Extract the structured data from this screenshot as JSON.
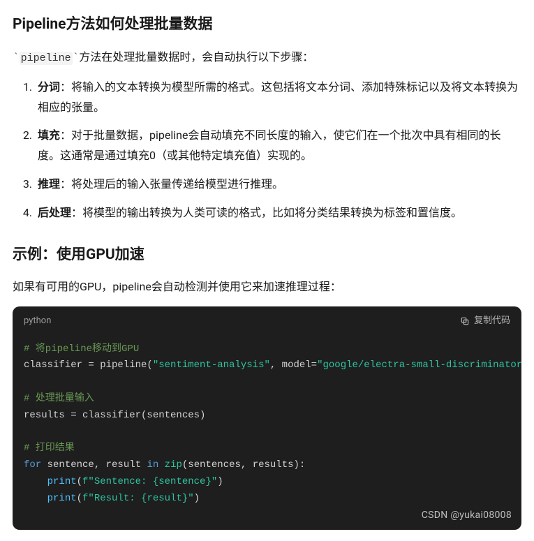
{
  "doc": {
    "h1": "Pipeline方法如何处理批量数据",
    "intro_prefix_tick": "`",
    "intro_code": "pipeline",
    "intro_suffix_tick": "`",
    "intro_rest": "方法在处理批量数据时，会自动执行以下步骤：",
    "steps": [
      {
        "term": "分词",
        "text": "：将输入的文本转换为模型所需的格式。这包括将文本分词、添加特殊标记以及将文本转换为相应的张量。"
      },
      {
        "term": "填充",
        "text": "：对于批量数据，pipeline会自动填充不同长度的输入，使它们在一个批次中具有相同的长度。这通常是通过填充0（或其他特定填充值）实现的。"
      },
      {
        "term": "推理",
        "text": "：将处理后的输入张量传递给模型进行推理。"
      },
      {
        "term": "后处理",
        "text": "：将模型的输出转换为人类可读的格式，比如将分类结果转换为标签和置信度。"
      }
    ],
    "h2": "示例：使用GPU加速",
    "p2": "如果有可用的GPU，pipeline会自动检测并使用它来加速推理过程：",
    "code": {
      "lang": "python",
      "copy_label": "复制代码",
      "lines": {
        "c1": "# 将pipeline移动到GPU",
        "l2a": "classifier = pipeline(",
        "l2s1": "\"sentiment-analysis\"",
        "l2b": ", model=",
        "l2s2": "\"google/electra-small-discriminator\"",
        "c3": "# 处理批量输入",
        "l4": "results = classifier(sentences)",
        "c5": "# 打印结果",
        "l6_for": "for",
        "l6_mid": " sentence, result ",
        "l6_in": "in",
        "l6_sp": " ",
        "l6_zip": "zip",
        "l6_rest": "(sentences, results):",
        "l7_print": "print",
        "l7_open": "(",
        "l7_str": "f\"Sentence: {sentence}\"",
        "l7_close": ")",
        "l8_print": "print",
        "l8_open": "(",
        "l8_str": "f\"Result: {result}\"",
        "l8_close": ")"
      }
    },
    "watermark": "CSDN @yukai08008"
  }
}
